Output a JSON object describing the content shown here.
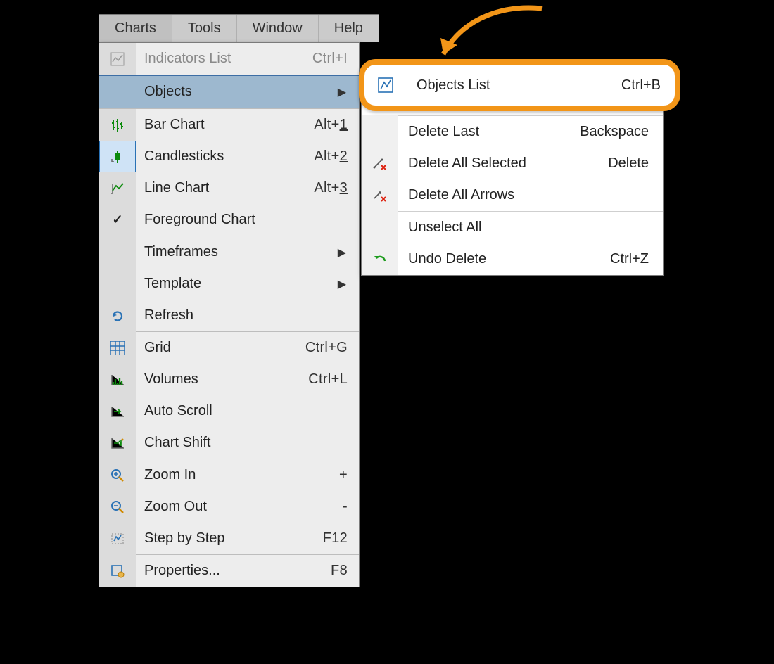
{
  "menubar": {
    "charts": "Charts",
    "tools": "Tools",
    "window": "Window",
    "help": "Help"
  },
  "menu": {
    "indicators": {
      "label": "Indicators List",
      "shortcut": "Ctrl+I"
    },
    "objects": {
      "label": "Objects"
    },
    "bar": {
      "label": "Bar Chart",
      "shortcut_prefix": "Alt+",
      "shortcut_key": "1"
    },
    "candle": {
      "label": "Candlesticks",
      "shortcut_prefix": "Alt+",
      "shortcut_key": "2"
    },
    "line": {
      "label": "Line Chart",
      "shortcut_prefix": "Alt+",
      "shortcut_key": "3"
    },
    "foreground": {
      "label": "Foreground Chart"
    },
    "timeframes": {
      "label": "Timeframes"
    },
    "template": {
      "label": "Template"
    },
    "refresh": {
      "label": "Refresh"
    },
    "grid": {
      "label": "Grid",
      "shortcut": "Ctrl+G"
    },
    "volumes": {
      "label": "Volumes",
      "shortcut": "Ctrl+L"
    },
    "autoscroll": {
      "label": "Auto Scroll"
    },
    "chartshift": {
      "label": "Chart Shift"
    },
    "zoomin": {
      "label": "Zoom In",
      "shortcut": "+"
    },
    "zoomout": {
      "label": "Zoom Out",
      "shortcut": "-"
    },
    "step": {
      "label": "Step by Step",
      "shortcut": "F12"
    },
    "properties": {
      "label": "Properties...",
      "shortcut": "F8"
    }
  },
  "submenu": {
    "objlist": {
      "label": "Objects List",
      "shortcut": "Ctrl+B"
    },
    "dellast": {
      "label": "Delete Last",
      "shortcut": "Backspace"
    },
    "delsel": {
      "label": "Delete All Selected",
      "shortcut": "Delete"
    },
    "delarrows": {
      "label": "Delete All Arrows"
    },
    "unselect": {
      "label": "Unselect All"
    },
    "undo": {
      "label": "Undo Delete",
      "shortcut": "Ctrl+Z"
    }
  }
}
